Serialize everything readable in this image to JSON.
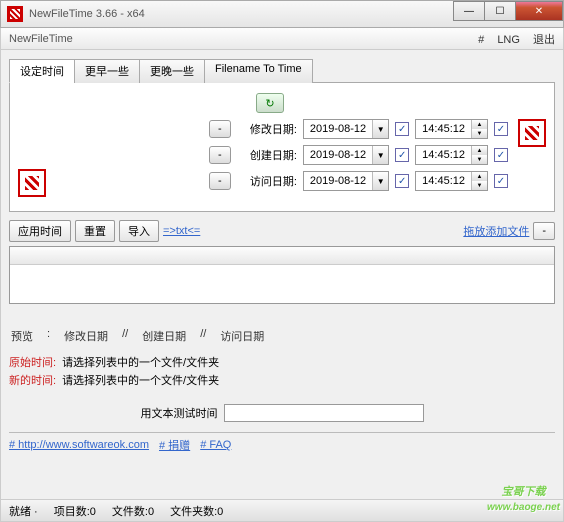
{
  "window": {
    "title": "NewFileTime 3.66 - x64"
  },
  "menubar": {
    "app": "NewFileTime",
    "hash": "#",
    "lng": "LNG",
    "exit": "退出"
  },
  "tabs": [
    "设定时间",
    "更早一些",
    "更晚一些",
    "Filename To Time"
  ],
  "rows": {
    "modify": {
      "label": "修改日期:",
      "date": "2019-08-12",
      "time": "14:45:12"
    },
    "create": {
      "label": "创建日期:",
      "date": "2019-08-12",
      "time": "14:45:12"
    },
    "access": {
      "label": "访问日期:",
      "date": "2019-08-12",
      "time": "14:45:12"
    }
  },
  "toolbar": {
    "apply": "应用时间",
    "reset": "重置",
    "import": "导入",
    "txt": "=>txt<=",
    "dragdrop": "拖放添加文件",
    "minus": "-"
  },
  "preview": {
    "label": "预览",
    "m": "修改日期",
    "c": "创建日期",
    "a": "访问日期",
    "sep": "//"
  },
  "info": {
    "origLabel": "原始时间:",
    "origText": "请选择列表中的一个文件/文件夹",
    "newLabel": "新的时间:",
    "newText": "请选择列表中的一个文件/文件夹"
  },
  "test": {
    "label": "用文本测试时间"
  },
  "footer": {
    "url": "# http://www.softwareok.com",
    "donate": "# 捐赠",
    "faq": "# FAQ"
  },
  "status": {
    "ready": "就绪",
    "items": "项目数:0",
    "files": "文件数:0",
    "folders": "文件夹数:0"
  },
  "watermark": {
    "main": "宝哥下载",
    "sub": "www.baoge.net"
  }
}
